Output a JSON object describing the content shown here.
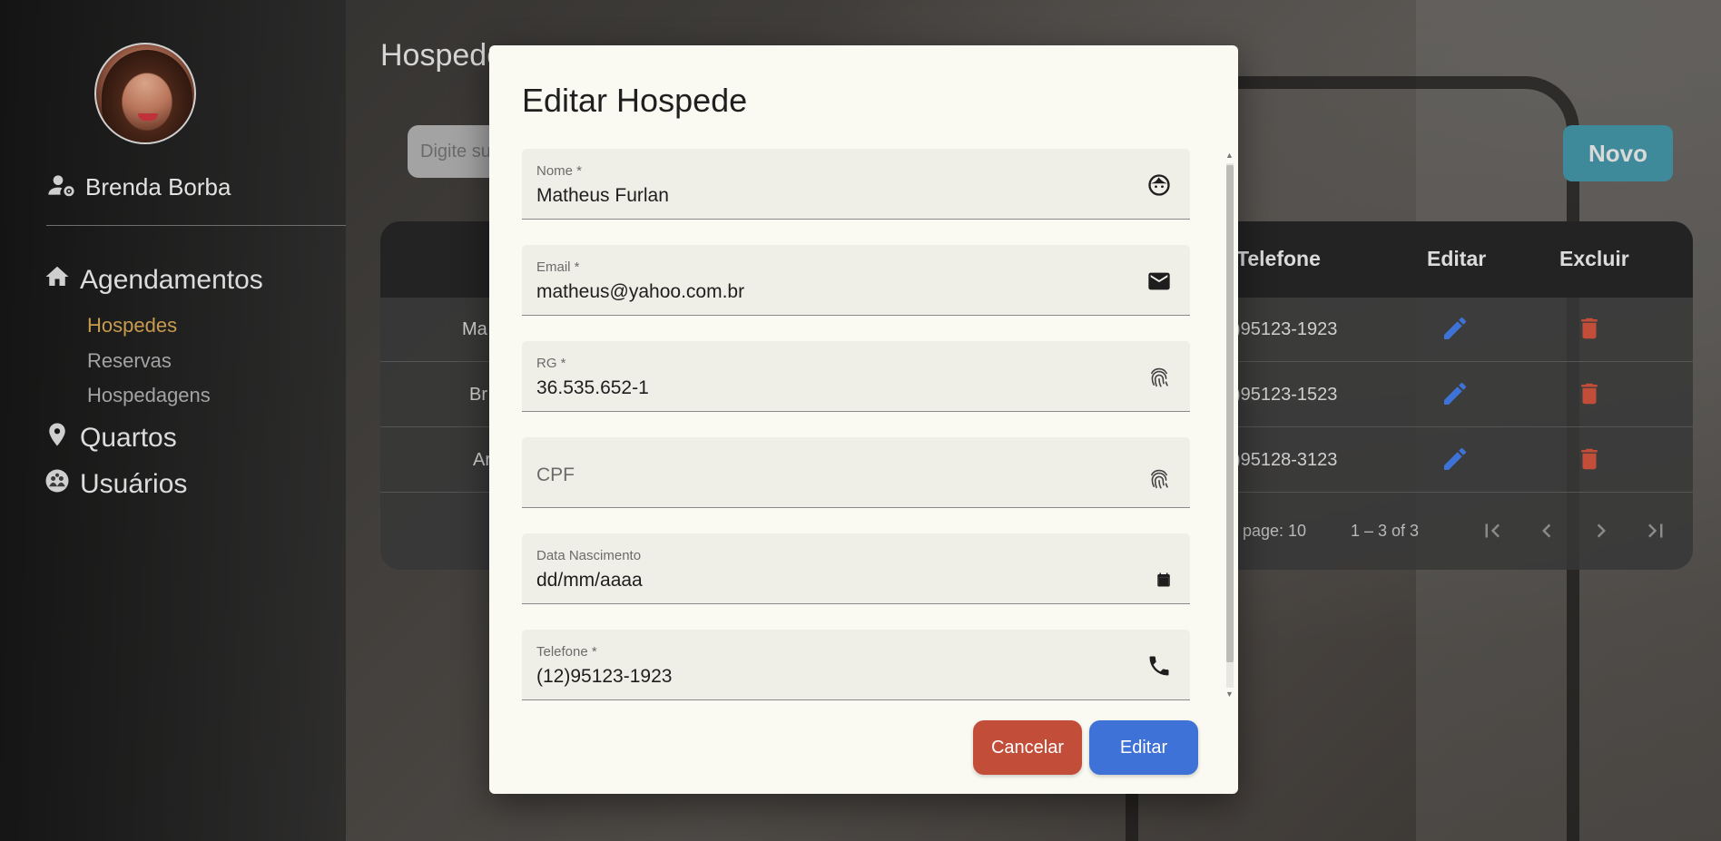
{
  "user": {
    "name": "Brenda Borba"
  },
  "nav": {
    "agendamentos": "Agendamentos",
    "sub": [
      "Hospedes",
      "Reservas",
      "Hospedagens"
    ],
    "quartos": "Quartos",
    "usuarios": "Usuários"
  },
  "page": {
    "title": "Hospede",
    "search_placeholder": "Digite su",
    "new_button": "Novo"
  },
  "table": {
    "headers": {
      "telefone": "Telefone",
      "editar": "Editar",
      "excluir": "Excluir"
    },
    "rows": [
      {
        "name_fragment": "Ma",
        "phone_fragment": ")95123-1923"
      },
      {
        "name_fragment": "Br",
        "phone_fragment": ")95123-1523"
      },
      {
        "name_fragment": "Ar",
        "phone_fragment": ")95128-3123"
      }
    ],
    "per_page_label": "r page: 10",
    "range_label": "1 – 3 of 3"
  },
  "modal": {
    "title": "Editar Hospede",
    "fields": {
      "nome": {
        "label": "Nome *",
        "value": "Matheus Furlan"
      },
      "email": {
        "label": "Email *",
        "value": "matheus@yahoo.com.br"
      },
      "rg": {
        "label": "RG *",
        "value": "36.535.652-1"
      },
      "cpf": {
        "placeholder": "CPF"
      },
      "nascimento": {
        "label": "Data Nascimento",
        "value": "dd/mm/aaaa"
      },
      "telefone": {
        "label": "Telefone *",
        "value": "(12)95123-1923"
      }
    },
    "cancel_label": "Cancelar",
    "edit_label": "Editar"
  },
  "colors": {
    "active_nav": "#c89b4e",
    "edit_icon": "#3f72d6",
    "delete_icon": "#c24e3a",
    "novo_button": "#3f8a9a"
  }
}
